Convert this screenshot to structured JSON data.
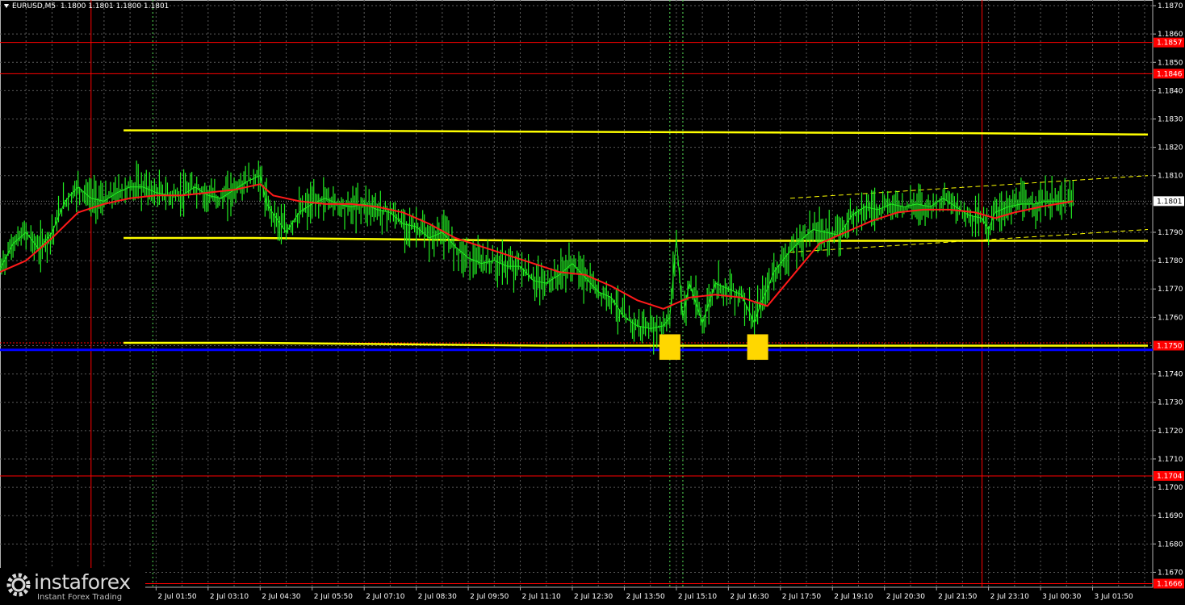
{
  "header": {
    "symbol_timeframe": "EURUSD,M5",
    "ohlc": "1.1800 1.1801 1.1800 1.1801"
  },
  "logo": {
    "brand": "instaforex",
    "tagline": "Instant Forex Trading"
  },
  "colors": {
    "background": "#000000",
    "grid": "#5a5a5a",
    "candles": "#22ee22",
    "moving_average": "#ff1a1a",
    "levels": "#ffff00",
    "support": "#0000ff",
    "red_lines": "#ff0000",
    "signal_boxes": "#ffd700",
    "vline_dotted": "#55dd55"
  },
  "chart_data": {
    "type": "line",
    "title": "EURUSD,M5",
    "ylim": [
      1.1665,
      1.1872
    ],
    "y_ticks": [
      "1.1870",
      "1.1860",
      "1.1850",
      "1.1840",
      "1.1830",
      "1.1820",
      "1.1810",
      "1.1790",
      "1.1780",
      "1.1770",
      "1.1760",
      "1.1740",
      "1.1730",
      "1.1720",
      "1.1710",
      "1.1700",
      "1.1690",
      "1.1680",
      "1.1670"
    ],
    "x_ticks": [
      "2 Jul 01:50",
      "2 Jul 03:10",
      "2 Jul 04:30",
      "2 Jul 05:50",
      "2 Jul 07:10",
      "2 Jul 08:30",
      "2 Jul 09:50",
      "2 Jul 11:10",
      "2 Jul 12:30",
      "2 Jul 13:50",
      "2 Jul 15:10",
      "2 Jul 16:30",
      "2 Jul 17:50",
      "2 Jul 19:10",
      "2 Jul 20:30",
      "2 Jul 21:50",
      "2 Jul 23:10",
      "3 Jul 00:30",
      "3 Jul 01:50"
    ],
    "x_tick_index": [
      0,
      16,
      32,
      48,
      64,
      80,
      96,
      112,
      128,
      144,
      160,
      176,
      192,
      208,
      224,
      240,
      256,
      272,
      288
    ],
    "x_first_index": -48,
    "x_last_index": 305,
    "current_price": {
      "value": 1.1801,
      "label": "1.1801"
    },
    "price_labels": [
      {
        "value": 1.1857,
        "label": "1.1857"
      },
      {
        "value": 1.1846,
        "label": "1.1846"
      },
      {
        "value": 1.175,
        "label": "1.1750"
      },
      {
        "value": 1.1704,
        "label": "1.1704"
      },
      {
        "value": 1.1666,
        "label": "1.1666"
      }
    ],
    "red_horizontal_levels": [
      1.1857,
      1.1846,
      1.1704,
      1.1666
    ],
    "red_dotted_level": 1.1751,
    "blue_support_level": 1.17485,
    "red_vertical_lines_index": [
      -20,
      254
    ],
    "green_dotted_vertical_index": [
      -1,
      158,
      162
    ],
    "yellow_levels": [
      {
        "x_start_index": -10,
        "points": [
          [
            -10,
            1.1826
          ],
          [
            30,
            1.1826
          ],
          [
            120,
            1.18255
          ],
          [
            250,
            1.1825
          ],
          [
            305,
            1.18245
          ]
        ]
      },
      {
        "x_start_index": -10,
        "points": [
          [
            -10,
            1.1788
          ],
          [
            30,
            1.1788
          ],
          [
            120,
            1.1787
          ],
          [
            250,
            1.1787
          ],
          [
            305,
            1.1787
          ]
        ]
      },
      {
        "x_start_index": -10,
        "points": [
          [
            -10,
            1.1751
          ],
          [
            30,
            1.1751
          ],
          [
            120,
            1.175
          ],
          [
            250,
            1.175
          ],
          [
            305,
            1.175
          ]
        ]
      }
    ],
    "channel_lines": [
      {
        "points": [
          [
            195,
            1.1802
          ],
          [
            305,
            1.181
          ]
        ]
      },
      {
        "points": [
          [
            195,
            1.1783
          ],
          [
            305,
            1.1791
          ]
        ]
      }
    ],
    "signal_boxes": [
      {
        "x_index": 158,
        "y_top": 1.1754,
        "y_bottom": 1.1745
      },
      {
        "x_index": 185,
        "y_top": 1.1754,
        "y_bottom": 1.1745
      }
    ],
    "series": [
      {
        "name": "price",
        "points": [
          [
            -48,
            1.1777
          ],
          [
            -44,
            1.1786
          ],
          [
            -40,
            1.179
          ],
          [
            -36,
            1.1784
          ],
          [
            -32,
            1.179
          ],
          [
            -28,
            1.1801
          ],
          [
            -24,
            1.1806
          ],
          [
            -20,
            1.1802
          ],
          [
            -16,
            1.1801
          ],
          [
            -12,
            1.1804
          ],
          [
            -8,
            1.1806
          ],
          [
            -4,
            1.1806
          ],
          [
            0,
            1.1804
          ],
          [
            4,
            1.1803
          ],
          [
            8,
            1.1803
          ],
          [
            12,
            1.1806
          ],
          [
            16,
            1.1803
          ],
          [
            20,
            1.1802
          ],
          [
            24,
            1.1805
          ],
          [
            28,
            1.1808
          ],
          [
            32,
            1.181
          ],
          [
            34,
            1.18
          ],
          [
            37,
            1.1795
          ],
          [
            40,
            1.179
          ],
          [
            44,
            1.1797
          ],
          [
            48,
            1.18
          ],
          [
            52,
            1.1802
          ],
          [
            56,
            1.18
          ],
          [
            60,
            1.1799
          ],
          [
            64,
            1.18
          ],
          [
            68,
            1.1798
          ],
          [
            72,
            1.1797
          ],
          [
            76,
            1.1793
          ],
          [
            80,
            1.1792
          ],
          [
            84,
            1.1788
          ],
          [
            88,
            1.179
          ],
          [
            92,
            1.1785
          ],
          [
            96,
            1.1781
          ],
          [
            100,
            1.1779
          ],
          [
            104,
            1.178
          ],
          [
            108,
            1.1778
          ],
          [
            112,
            1.1778
          ],
          [
            116,
            1.1773
          ],
          [
            120,
            1.1772
          ],
          [
            124,
            1.1775
          ],
          [
            128,
            1.1779
          ],
          [
            132,
            1.1774
          ],
          [
            136,
            1.1769
          ],
          [
            140,
            1.1767
          ],
          [
            144,
            1.176
          ],
          [
            148,
            1.1757
          ],
          [
            152,
            1.1756
          ],
          [
            156,
            1.1757
          ],
          [
            158,
            1.176
          ],
          [
            160,
            1.1788
          ],
          [
            162,
            1.176
          ],
          [
            164,
            1.1772
          ],
          [
            168,
            1.1758
          ],
          [
            172,
            1.1772
          ],
          [
            176,
            1.177
          ],
          [
            180,
            1.1768
          ],
          [
            184,
            1.1758
          ],
          [
            186,
            1.1765
          ],
          [
            188,
            1.177
          ],
          [
            190,
            1.1776
          ],
          [
            194,
            1.1782
          ],
          [
            198,
            1.1787
          ],
          [
            202,
            1.1791
          ],
          [
            206,
            1.179
          ],
          [
            210,
            1.1789
          ],
          [
            214,
            1.1796
          ],
          [
            218,
            1.1799
          ],
          [
            222,
            1.1798
          ],
          [
            226,
            1.18
          ],
          [
            230,
            1.1799
          ],
          [
            234,
            1.18
          ],
          [
            238,
            1.1799
          ],
          [
            242,
            1.1802
          ],
          [
            246,
            1.1799
          ],
          [
            250,
            1.1796
          ],
          [
            254,
            1.1795
          ],
          [
            256,
            1.1791
          ],
          [
            258,
            1.1797
          ],
          [
            262,
            1.1799
          ],
          [
            266,
            1.18
          ],
          [
            270,
            1.18
          ],
          [
            274,
            1.1801
          ],
          [
            278,
            1.1801
          ],
          [
            282,
            1.1801
          ]
        ]
      },
      {
        "name": "moving_average",
        "points": [
          [
            -48,
            1.1776
          ],
          [
            -40,
            1.178
          ],
          [
            -32,
            1.1788
          ],
          [
            -24,
            1.1797
          ],
          [
            -16,
            1.18
          ],
          [
            -8,
            1.1802
          ],
          [
            0,
            1.1803
          ],
          [
            8,
            1.1803
          ],
          [
            16,
            1.1804
          ],
          [
            24,
            1.1805
          ],
          [
            32,
            1.1807
          ],
          [
            36,
            1.1803
          ],
          [
            44,
            1.1801
          ],
          [
            52,
            1.18
          ],
          [
            60,
            1.18
          ],
          [
            68,
            1.1799
          ],
          [
            76,
            1.1797
          ],
          [
            84,
            1.1793
          ],
          [
            92,
            1.1788
          ],
          [
            100,
            1.1785
          ],
          [
            108,
            1.1782
          ],
          [
            116,
            1.1779
          ],
          [
            124,
            1.1776
          ],
          [
            132,
            1.1775
          ],
          [
            140,
            1.1771
          ],
          [
            148,
            1.1766
          ],
          [
            156,
            1.1763
          ],
          [
            164,
            1.1767
          ],
          [
            172,
            1.1768
          ],
          [
            180,
            1.1767
          ],
          [
            188,
            1.1764
          ],
          [
            196,
            1.1775
          ],
          [
            204,
            1.1786
          ],
          [
            212,
            1.179
          ],
          [
            220,
            1.1794
          ],
          [
            228,
            1.1797
          ],
          [
            236,
            1.1798
          ],
          [
            244,
            1.1798
          ],
          [
            252,
            1.1797
          ],
          [
            258,
            1.1795
          ],
          [
            264,
            1.1797
          ],
          [
            272,
            1.1799
          ],
          [
            282,
            1.1801
          ]
        ]
      }
    ]
  }
}
